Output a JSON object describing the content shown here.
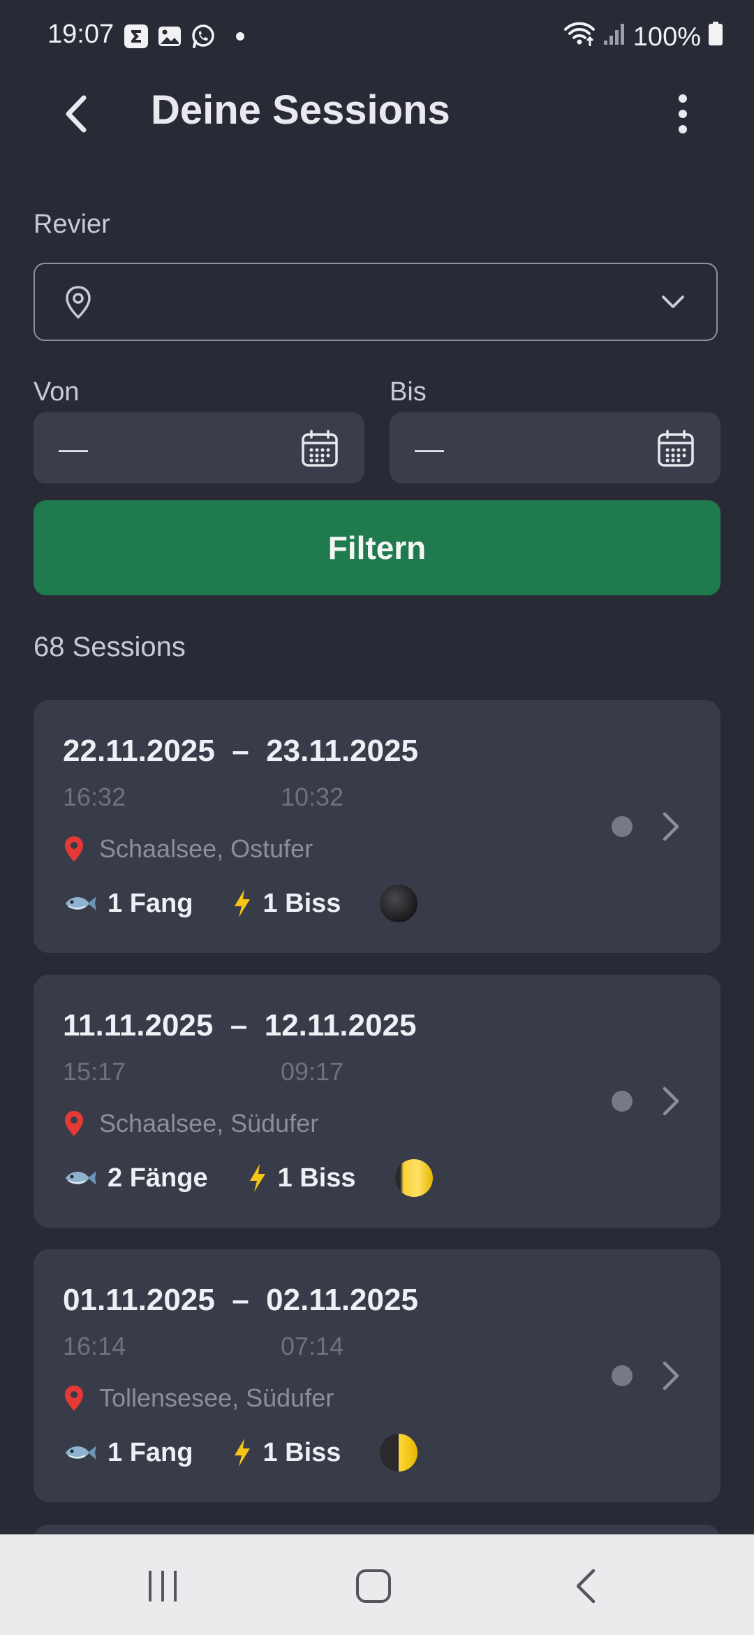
{
  "status_bar": {
    "time": "19:07",
    "battery": "100%",
    "icons": [
      "sigma-app-icon",
      "gallery-icon",
      "whatsapp-icon",
      "wifi-icon",
      "signal-icon",
      "battery-icon"
    ]
  },
  "header": {
    "title": "Deine Sessions"
  },
  "filters": {
    "revier_label": "Revier",
    "revier_value": "",
    "von_label": "Von",
    "von_value": "—",
    "bis_label": "Bis",
    "bis_value": "—",
    "filter_button": "Filtern"
  },
  "summary": {
    "count_text": "68 Sessions"
  },
  "sessions": [
    {
      "dates": "22.11.2025  –  23.11.2025",
      "start_time": "16:32",
      "end_time": "10:32",
      "location": "Schaalsee, Ostufer",
      "catches": "1 Fang",
      "bites": "1 Biss",
      "moon_phase": "new-moon-icon"
    },
    {
      "dates": "11.11.2025  –  12.11.2025",
      "start_time": "15:17",
      "end_time": "09:17",
      "location": "Schaalsee, Südufer",
      "catches": "2 Fänge",
      "bites": "1 Biss",
      "moon_phase": "waxing-gibbous-moon-icon"
    },
    {
      "dates": "01.11.2025  –  02.11.2025",
      "start_time": "16:14",
      "end_time": "07:14",
      "location": "Tollensesee, Südufer",
      "catches": "1 Fang",
      "bites": "1 Biss",
      "moon_phase": "first-quarter-moon-icon"
    }
  ],
  "colors": {
    "background": "#282b36",
    "card": "#383b48",
    "accent_green": "#1f7a4d",
    "location_pin": "#e53935",
    "bolt": "#f5c518"
  }
}
